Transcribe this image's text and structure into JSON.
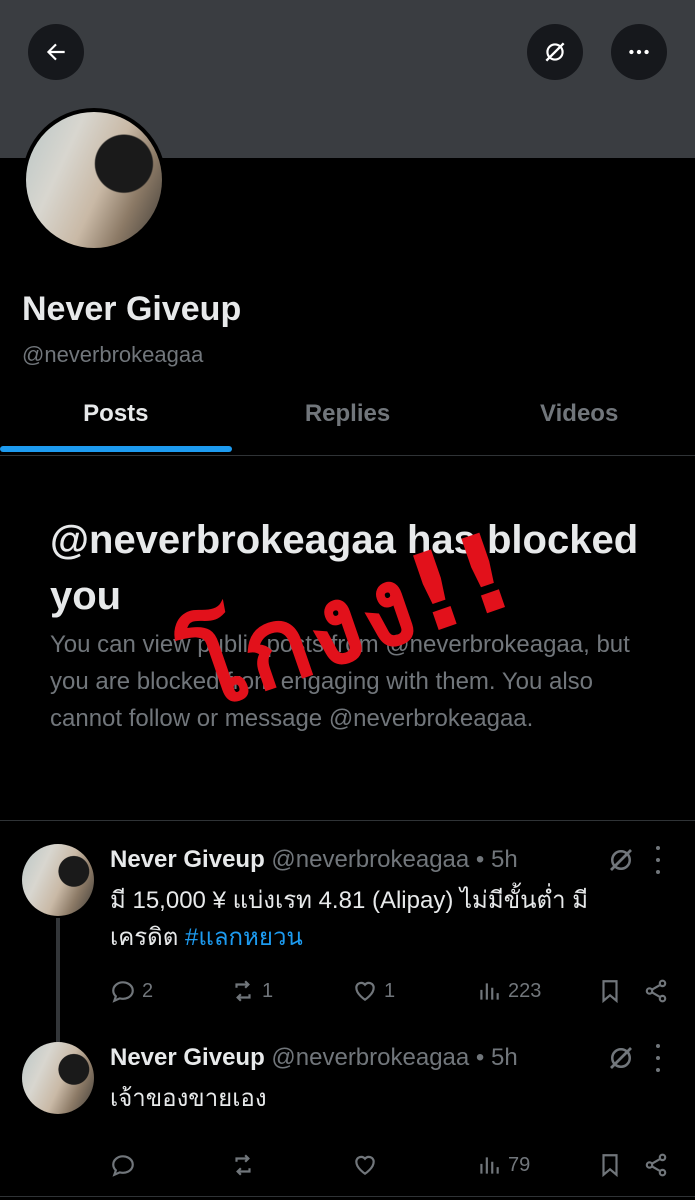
{
  "profile": {
    "display_name": "Never Giveup",
    "handle": "@neverbrokeagaa"
  },
  "header": {
    "icons": [
      "back-arrow-icon",
      "grok-icon",
      "more-icon"
    ]
  },
  "tabs": [
    {
      "label": "Posts",
      "active": true
    },
    {
      "label": "Replies",
      "active": false
    },
    {
      "label": "Videos",
      "active": false
    }
  ],
  "blocked": {
    "title": "@neverbrokeagaa has blocked you",
    "body": "You can view public posts from @neverbrokeagaa, but you are blocked from engaging with them. You also cannot follow or message @neverbrokeagaa."
  },
  "overlay_stamp": "โกงง!!",
  "posts": [
    {
      "name": "Never Giveup",
      "meta": "@neverbrokeagaa • 5h",
      "text": "มี 15,000 ¥ แบ่งเรท 4.81 (Alipay) ไม่มีขั้นต่ำ  มีเครดิต ",
      "hashtag": "#แลกหยวน",
      "replies": "2",
      "reposts": "1",
      "likes": "1",
      "views": "223"
    },
    {
      "name": "Never Giveup",
      "meta": "@neverbrokeagaa • 5h",
      "text": "เจ้าของขายเอง",
      "hashtag": "",
      "replies": "",
      "reposts": "",
      "likes": "",
      "views": "79"
    }
  ],
  "colors": {
    "accent": "#1d9bf0",
    "stamp": "#e2111b",
    "muted": "#71767b",
    "banner": "#3a3d41"
  }
}
